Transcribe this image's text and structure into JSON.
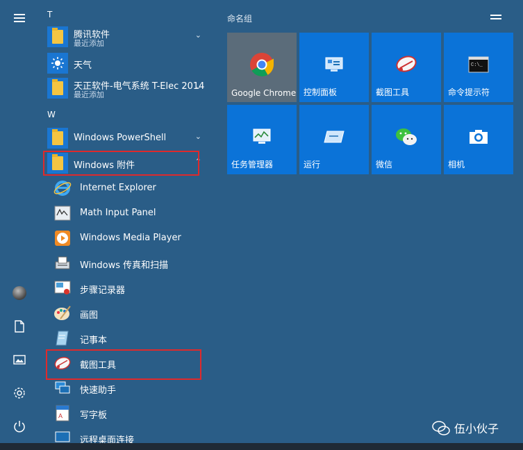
{
  "rail": {
    "icons": [
      "menu-icon",
      "user-avatar",
      "document-icon",
      "pictures-icon",
      "settings-icon",
      "power-icon"
    ]
  },
  "applist": {
    "letter_t": "T",
    "letter_w": "W",
    "items": [
      {
        "name": "腾讯软件",
        "sub": "最近添加",
        "chev": "v"
      },
      {
        "name": "天气"
      },
      {
        "name": "天正软件-电气系统 T-Elec 2014",
        "sub": "最近添加",
        "chev": "v"
      },
      {
        "name": "Windows PowerShell",
        "chev": "v"
      },
      {
        "name": "Windows 附件",
        "chev": "^"
      }
    ],
    "sub_items": [
      "Internet Explorer",
      "Math Input Panel",
      "Windows Media Player",
      "Windows 传真和扫描",
      "步骤记录器",
      "画图",
      "记事本",
      "截图工具",
      "快速助手",
      "写字板",
      "远程桌面连接"
    ]
  },
  "tiles": {
    "group_title": "命名组",
    "items": [
      {
        "label": "Google Chrome"
      },
      {
        "label": "控制面板"
      },
      {
        "label": "截图工具"
      },
      {
        "label": "命令提示符"
      },
      {
        "label": "任务管理器"
      },
      {
        "label": "运行"
      },
      {
        "label": "微信"
      },
      {
        "label": "相机"
      }
    ]
  },
  "watermark": "伍小伙子",
  "colors": {
    "background": "#2a5d87",
    "tile": "#0b73d8",
    "highlight": "#e0292b"
  }
}
